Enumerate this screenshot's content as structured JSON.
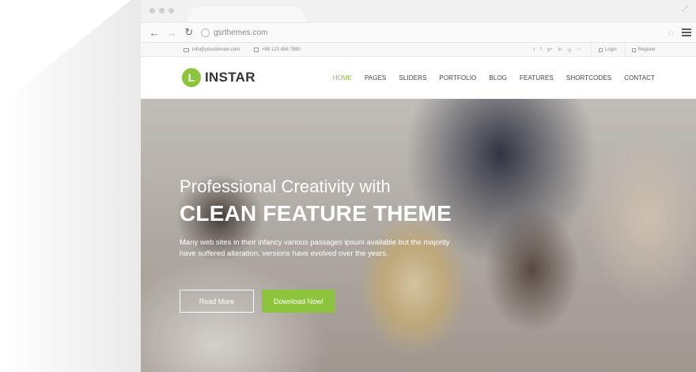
{
  "browser": {
    "url": "gsrthemes.com"
  },
  "topbar": {
    "email": "info@yourdomain.com",
    "phone": "+88 123 456 7890",
    "social": [
      "twitter-icon",
      "facebook-icon",
      "google-plus-icon",
      "linkedin-icon",
      "dribbble-icon",
      "rss-icon"
    ],
    "login_label": "Login",
    "register_label": "Register"
  },
  "header": {
    "logo_letter": "L",
    "logo_text": "INSTAR",
    "nav": [
      {
        "label": "HOME"
      },
      {
        "label": "PAGES"
      },
      {
        "label": "SLIDERS"
      },
      {
        "label": "PORTFOLIO"
      },
      {
        "label": "BLOG"
      },
      {
        "label": "FEATURES"
      },
      {
        "label": "SHORTCODES"
      },
      {
        "label": "CONTACT"
      }
    ]
  },
  "hero": {
    "line1": "Professional Creativity with",
    "line2": "CLEAN FEATURE THEME",
    "description": "Many web sites in their infancy various passages ipsum available but the majority have suffered alteration, versions have evolved over the years.",
    "primary_label": "Read More",
    "secondary_label": "Download Now!"
  },
  "colors": {
    "accent": "#8cc43d",
    "text_dark": "#333333"
  }
}
